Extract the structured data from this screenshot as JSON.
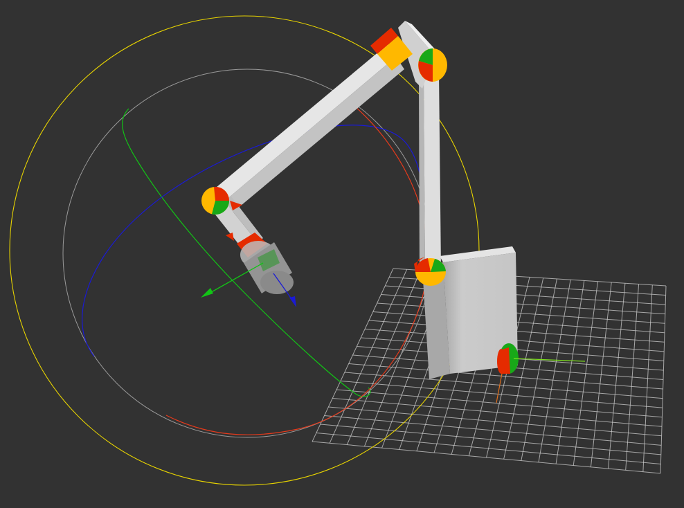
{
  "viewport": {
    "background": "#323232",
    "grid": {
      "visible": true,
      "color": "#cfcfcf"
    }
  },
  "gizmo": {
    "outer_ring_color": "#e8d400",
    "trackball_color": "#9a9a9a",
    "x_axis_color": "#e53a1c",
    "y_axis_color": "#12c416",
    "z_axis_color": "#1a1ad6"
  },
  "robot": {
    "link_color": "#dedede",
    "joint_colors": {
      "red": "#e52b00",
      "yellow": "#ffb800",
      "green": "#18a818"
    },
    "end_effector": "tool-cylinder"
  },
  "base_frame": {
    "x_axis_color": "#7ee01e",
    "z_axis_color": "#e0701e"
  }
}
